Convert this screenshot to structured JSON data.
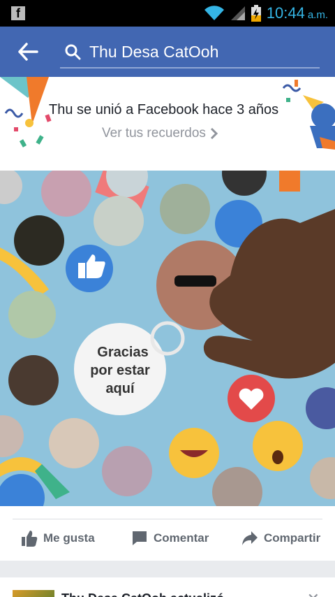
{
  "status_bar": {
    "app_icon": "f",
    "time": "10:44",
    "ampm": "a.m."
  },
  "search": {
    "query": "Thu Desa CatOoh"
  },
  "memory_card": {
    "message": "Thu se unió a Facebook hace 3 años",
    "link_label": "Ver tus recuerdos"
  },
  "photo": {
    "button_text_line1": "Gracias",
    "button_text_line2": "por estar",
    "button_text_line3": "aquí"
  },
  "actions": {
    "like_label": "Me gusta",
    "comment_label": "Comentar",
    "share_label": "Compartir"
  },
  "next_post": {
    "title_partial": "Thu Desa CatOoh actualizó"
  },
  "colors": {
    "fb_blue": "#4267b2",
    "status_time": "#35b5e5",
    "link_gray": "#90949c",
    "action_gray": "#606770"
  }
}
